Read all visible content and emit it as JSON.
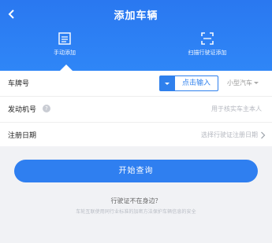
{
  "header": {
    "title": "添加车辆",
    "modes": [
      {
        "label": "手动添加",
        "icon": "form-list-icon"
      },
      {
        "label": "扫描行驶证添加",
        "icon": "scan-frame-icon"
      }
    ]
  },
  "form": {
    "rows": [
      {
        "label": "车牌号",
        "plate_input": "点击输入",
        "vehicle_type": "小型汽车"
      },
      {
        "label": "发动机号",
        "placeholder": "用于核实车主本人"
      },
      {
        "label": "注册日期",
        "placeholder": "选择行驶证注册日期"
      }
    ]
  },
  "submit_label": "开始查询",
  "note": {
    "question": "行驶证不在身边？",
    "hint": "车轮互联使用同行业标准的加密方法保护车辆信息的安全"
  },
  "colors": {
    "primary": "#2f80ed",
    "header": "#2a78f0",
    "background": "#f1f2f5"
  }
}
